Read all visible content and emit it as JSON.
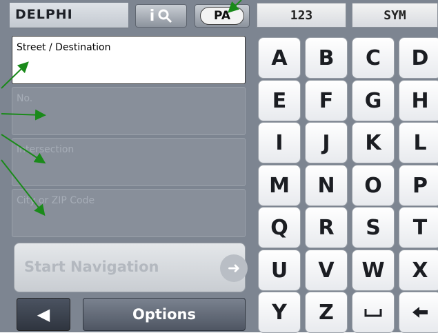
{
  "header": {
    "logo_text": "DELPHI",
    "info_label": "i",
    "state_button": "PA",
    "mode_numeric": "123",
    "mode_symbols": "SYM"
  },
  "fields": [
    {
      "label": "Street / Destination",
      "active": true
    },
    {
      "label": "No.",
      "active": false
    },
    {
      "label": "Intersection",
      "active": false
    },
    {
      "label": "City or ZIP Code",
      "active": false
    }
  ],
  "actions": {
    "start_navigation": "Start Navigation",
    "options": "Options"
  },
  "keyboard": {
    "rows": [
      [
        "A",
        "B",
        "C",
        "D"
      ],
      [
        "E",
        "F",
        "G",
        "H"
      ],
      [
        "I",
        "J",
        "K",
        "L"
      ],
      [
        "M",
        "N",
        "O",
        "P"
      ],
      [
        "Q",
        "R",
        "S",
        "T"
      ],
      [
        "U",
        "V",
        "W",
        "X"
      ],
      [
        "Y",
        "Z",
        "space",
        "backspace"
      ]
    ]
  },
  "colors": {
    "background": "#7d8591",
    "arrow_annotation": "#1a8a1a",
    "field_active": "#ffffff",
    "field_inactive": "#888f9a"
  }
}
